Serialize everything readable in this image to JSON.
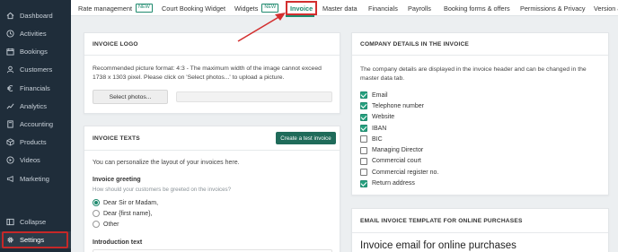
{
  "sidebar": {
    "items": [
      {
        "label": "Dashboard",
        "icon": "home-icon"
      },
      {
        "label": "Activities",
        "icon": "clock-icon"
      },
      {
        "label": "Bookings",
        "icon": "calendar-icon"
      },
      {
        "label": "Customers",
        "icon": "user-icon"
      },
      {
        "label": "Financials",
        "icon": "euro-icon"
      },
      {
        "label": "Analytics",
        "icon": "chart-line-icon"
      },
      {
        "label": "Accounting",
        "icon": "calculator-icon"
      },
      {
        "label": "Products",
        "icon": "cube-icon"
      },
      {
        "label": "Videos",
        "icon": "play-icon"
      },
      {
        "label": "Marketing",
        "icon": "megaphone-icon"
      }
    ],
    "collapse_label": "Collapse",
    "settings_label": "Settings"
  },
  "tabs": {
    "rate_management": "Rate management",
    "new_badge": "NEW",
    "court_booking": "Court Booking Widget",
    "widgets": "Widgets",
    "invoice": "Invoice",
    "master_data": "Master data",
    "financials": "Financials",
    "payrolls": "Payrolls",
    "booking_forms": "Booking forms & offers",
    "permissions": "Permissions & Privacy",
    "version": "Version &"
  },
  "invoice_logo": {
    "title": "INVOICE LOGO",
    "description": "Recommended picture format: 4:3 - The maximum width of the image cannot exceed 1738 x 1303 pixel. Please click on 'Select photos...' to upload a picture.",
    "select_button": "Select photos..."
  },
  "invoice_texts": {
    "title": "INVOICE TEXTS",
    "test_button": "Create a test invoice",
    "intro": "You can personalize the layout of your invoices here.",
    "greeting_label": "Invoice greeting",
    "greeting_hint": "How should your customers be greeted on the invoices?",
    "options": [
      {
        "label": "Dear Sir or Madam,",
        "selected": true
      },
      {
        "label": "Dear {first name},",
        "selected": false
      },
      {
        "label": "Other",
        "selected": false
      }
    ],
    "introduction_label": "Introduction text"
  },
  "company_details": {
    "title": "COMPANY DETAILS IN THE INVOICE",
    "description": "The company details are displayed in the invoice header and can be changed in the master data tab.",
    "items": [
      {
        "label": "Email",
        "checked": true
      },
      {
        "label": "Telephone number",
        "checked": true
      },
      {
        "label": "Website",
        "checked": true
      },
      {
        "label": "IBAN",
        "checked": true
      },
      {
        "label": "BIC",
        "checked": false
      },
      {
        "label": "Managing Director",
        "checked": false
      },
      {
        "label": "Commercial court",
        "checked": false
      },
      {
        "label": "Commercial register no.",
        "checked": false
      },
      {
        "label": "Return address",
        "checked": true
      }
    ]
  },
  "email_template": {
    "title": "EMAIL INVOICE TEMPLATE FOR ONLINE PURCHASES",
    "heading": "Invoice email for online purchases"
  },
  "colors": {
    "accent": "#1f8a6e",
    "highlight": "#d32f2f",
    "sidebar_bg": "#1f2d3a"
  }
}
